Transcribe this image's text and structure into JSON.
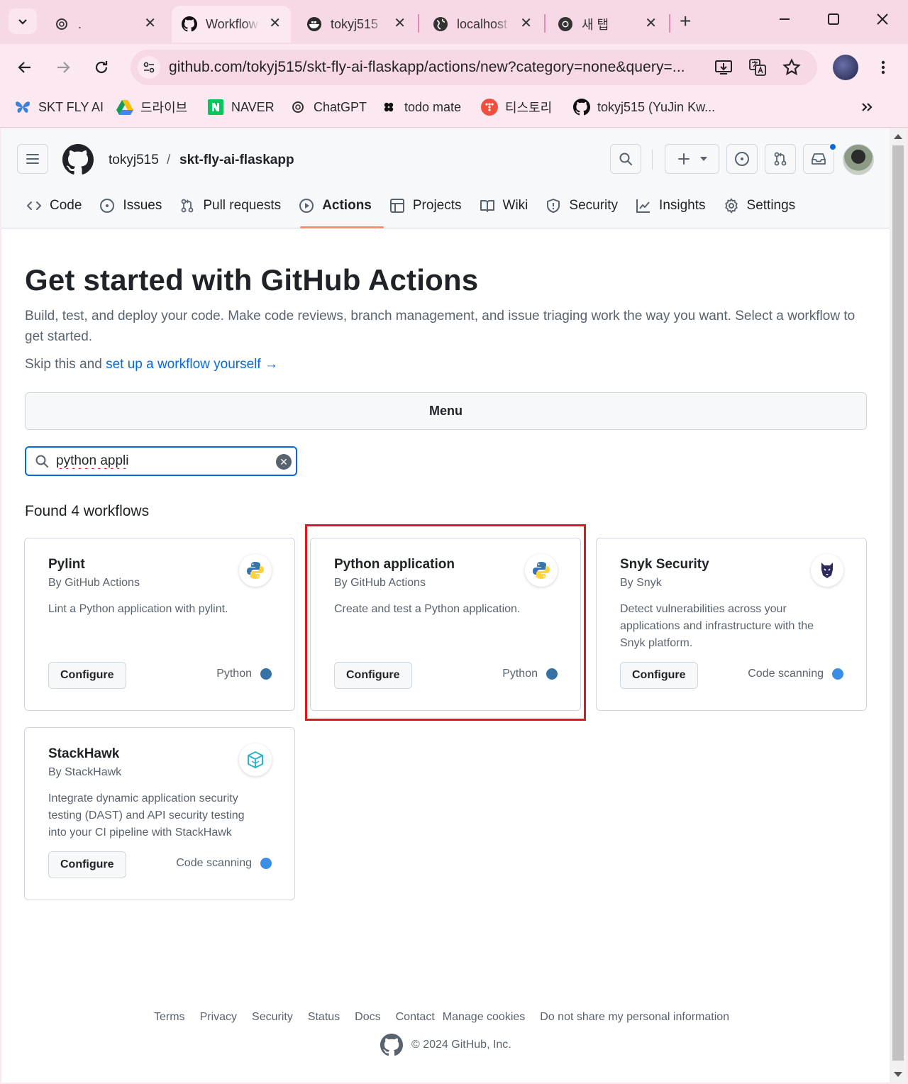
{
  "browser": {
    "tabs": [
      {
        "label": "."
      },
      {
        "label": "Workflow"
      },
      {
        "label": "tokyj515"
      },
      {
        "label": "localhost"
      },
      {
        "label": "새 탭"
      }
    ],
    "url": "github.com/tokyj515/skt-fly-ai-flaskapp/actions/new?category=none&query=...",
    "bookmarks": [
      "SKT FLY AI",
      "드라이브",
      "NAVER",
      "ChatGPT",
      "todo mate",
      "티스토리",
      "tokyj515 (YuJin Kw..."
    ]
  },
  "github": {
    "owner": "tokyj515",
    "separator": "/",
    "repo": "skt-fly-ai-flaskapp",
    "nav": [
      {
        "label": "Code",
        "icon": "code-icon"
      },
      {
        "label": "Issues",
        "icon": "issue-icon"
      },
      {
        "label": "Pull requests",
        "icon": "pull-request-icon"
      },
      {
        "label": "Actions",
        "icon": "play-icon"
      },
      {
        "label": "Projects",
        "icon": "table-icon"
      },
      {
        "label": "Wiki",
        "icon": "book-icon"
      },
      {
        "label": "Security",
        "icon": "shield-icon"
      },
      {
        "label": "Insights",
        "icon": "graph-icon"
      },
      {
        "label": "Settings",
        "icon": "gear-icon"
      }
    ],
    "selected_nav": "Actions"
  },
  "page": {
    "title": "Get started with GitHub Actions",
    "lead": "Build, test, and deploy your code. Make code reviews, branch management, and issue triaging work the way you want. Select a workflow to get started.",
    "skip_prefix": "Skip this and",
    "skip_link": "set up a workflow yourself",
    "skip_arrow": "→",
    "menu_label": "Menu",
    "search_value": "python appli",
    "found_text": "Found 4 workflows"
  },
  "workflows": [
    {
      "title": "Pylint",
      "by": "By GitHub Actions",
      "desc": "Lint a Python application with pylint.",
      "button": "Configure",
      "category": "Python",
      "dot_color": "#3572A5",
      "icon": "python-icon"
    },
    {
      "title": "Python application",
      "by": "By GitHub Actions",
      "desc": "Create and test a Python application.",
      "button": "Configure",
      "category": "Python",
      "dot_color": "#3572A5",
      "icon": "python-icon"
    },
    {
      "title": "Snyk Security",
      "by": "By Snyk",
      "desc": "Detect vulnerabilities across your applications and infrastructure with the Snyk platform.",
      "button": "Configure",
      "category": "Code scanning",
      "dot_color": "#3a8ee6",
      "icon": "snyk-icon"
    },
    {
      "title": "StackHawk",
      "by": "By StackHawk",
      "desc": "Integrate dynamic application security testing (DAST) and API security testing into your CI pipeline with StackHawk",
      "button": "Configure",
      "category": "Code scanning",
      "dot_color": "#3a8ee6",
      "icon": "stackhawk-icon"
    }
  ],
  "footer": {
    "links": [
      "Terms",
      "Privacy",
      "Security",
      "Status",
      "Docs",
      "Contact",
      "Manage cookies",
      "Do not share my personal information"
    ],
    "copyright": "© 2024 GitHub, Inc."
  },
  "colors": {
    "accent": "#0969da",
    "highlight": "#e0161e",
    "underline": "#fd8c73"
  }
}
